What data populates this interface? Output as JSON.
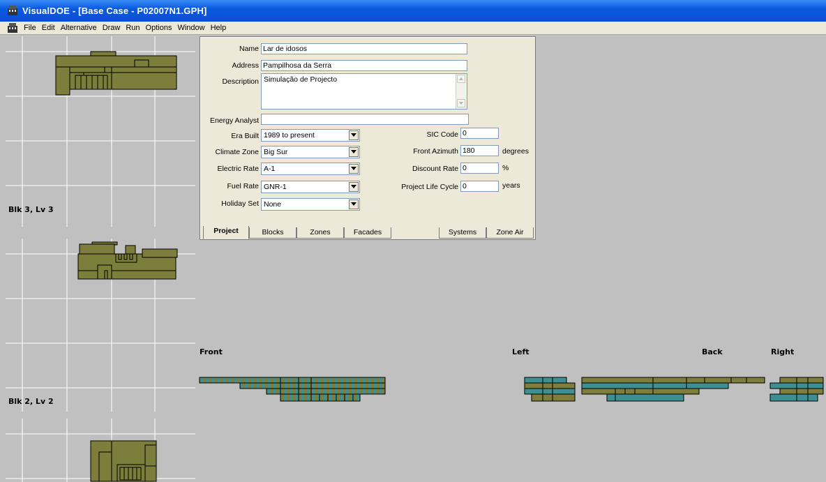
{
  "window": {
    "title": "VisualDOE - [Base Case - P02007N1.GPH]"
  },
  "menu": [
    "File",
    "Edit",
    "Alternative",
    "Draw",
    "Run",
    "Options",
    "Window",
    "Help"
  ],
  "floorplans": {
    "level_3": "Blk 3, Lv 3",
    "level_2": "Blk 2, Lv 2"
  },
  "project": {
    "name_label": "Name",
    "name_value": "Lar de idosos",
    "address_label": "Address",
    "address_value": "Pampilhosa da Serra",
    "description_label": "Description",
    "description_value": "Simulação de Projecto",
    "energy_analyst_label": "Energy Analyst",
    "energy_analyst_value": "",
    "era_built_label": "Era Built",
    "era_built_value": "1989 to present",
    "climate_zone_label": "Climate Zone",
    "climate_zone_value": "Big Sur",
    "electric_rate_label": "Electric Rate",
    "electric_rate_value": "A-1",
    "fuel_rate_label": "Fuel Rate",
    "fuel_rate_value": "GNR-1",
    "holiday_set_label": "Holiday Set",
    "holiday_set_value": "None",
    "sic_code_label": "SIC Code",
    "sic_code_value": "0",
    "front_azimuth_label": "Front Azimuth",
    "front_azimuth_value": "180",
    "front_azimuth_unit": "degrees",
    "discount_rate_label": "Discount Rate",
    "discount_rate_value": "0",
    "discount_rate_unit": "%",
    "life_cycle_label": "Project Life Cycle",
    "life_cycle_value": "0",
    "life_cycle_unit": "years"
  },
  "tabs": [
    "Project",
    "Blocks",
    "Zones",
    "Facades",
    "Systems",
    "Zone Air"
  ],
  "active_tab": "Project",
  "elevations": {
    "front": "Front",
    "left": "Left",
    "back": "Back",
    "right": "Right"
  },
  "colors": {
    "wall": "#7d7d3c",
    "window": "#3e8f92",
    "grid": "#ffffff",
    "background": "#c0c0c0",
    "titlebar": "#0a5ae0"
  }
}
